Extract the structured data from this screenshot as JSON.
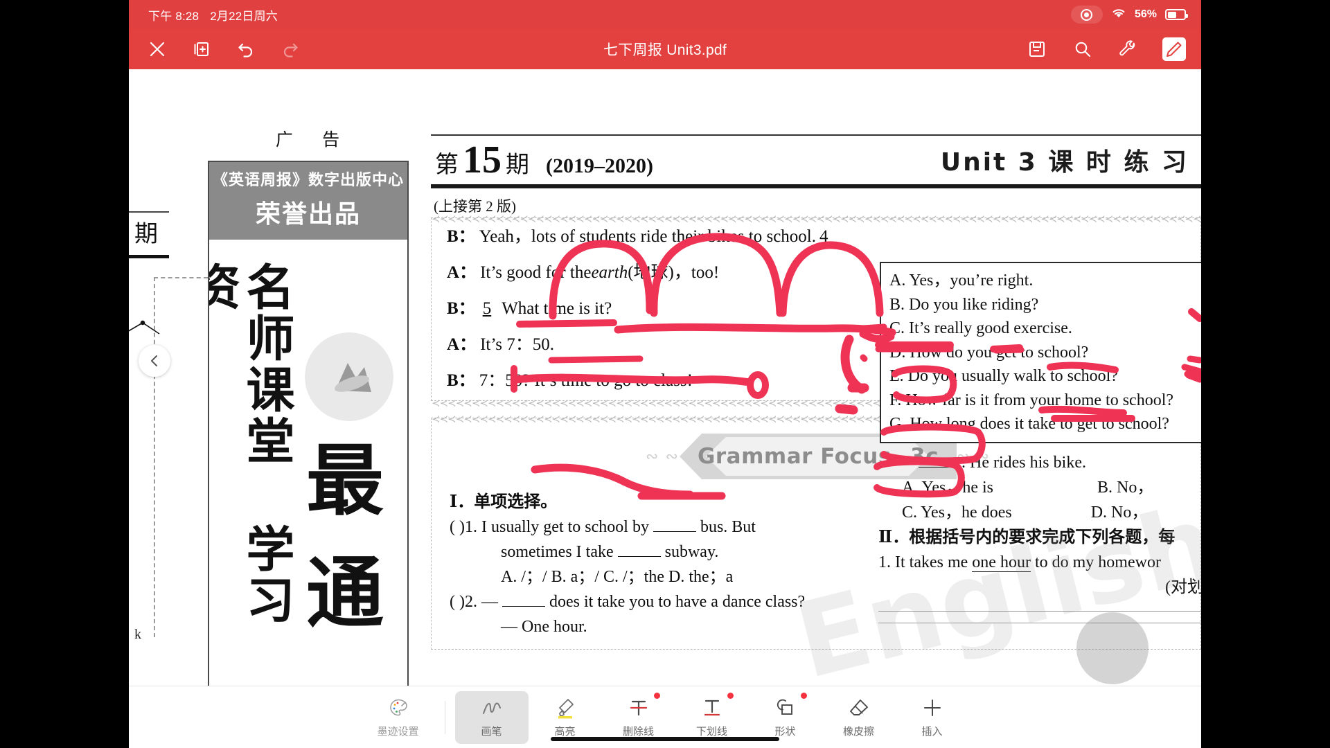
{
  "status_bar": {
    "time": "下午 8:28",
    "date": "2月22日周六",
    "battery_percent": "56%",
    "recording_icon": "record-icon",
    "wifi_icon": "wifi-icon",
    "battery_icon": "battery-icon"
  },
  "toolbar": {
    "title": "七下周报 Unit3.pdf",
    "close_icon": "close-icon",
    "add_page_icon": "add-page-icon",
    "undo_icon": "undo-icon",
    "redo_icon": "redo-icon",
    "save_icon": "save-icon",
    "search_icon": "search-icon",
    "settings_icon": "wrench-icon",
    "edit_icon": "pencil-icon",
    "accent_color": "#e3413f"
  },
  "left_fragment": {
    "qi": "期",
    "k": "k"
  },
  "ad": {
    "label": "广 告",
    "header_line1": "《英语周报》数字出版中心",
    "header_line2": "荣誉出品",
    "vertical_text": "名师课堂 学习资",
    "big1": "最",
    "big2": "通"
  },
  "document": {
    "issue_prefix": "第",
    "issue_number": "15",
    "issue_suffix": "期",
    "issue_years": "(2019–2020)",
    "unit_title": "Unit 3 课 时 练 习",
    "continued_note": "(上接第 2 版)",
    "dialogue": [
      {
        "speaker": "B：",
        "text": "Yeah，lots of students ride their bikes to school.",
        "blank": "4"
      },
      {
        "speaker": "A：",
        "text_pre": "It’s good for the ",
        "italic": "earth",
        "text_post": " (地球)，too!"
      },
      {
        "speaker": "B：",
        "blank": "5",
        "text": "What time is it?"
      },
      {
        "speaker": "A：",
        "text": "It’s 7：50."
      },
      {
        "speaker": "B：",
        "text": "7：50? It’s time to go to class!"
      }
    ],
    "options": [
      "A. Yes，you’re right.",
      "B. Do you like riding?",
      "C. It’s really good exercise.",
      "D. How do you get to school?",
      "E. Do you usually walk to school?",
      "F. How far is it from your home to school?",
      "G. How long does it take to get to school?"
    ],
    "grammar_focus": {
      "banner": "Grammar Focus –3c",
      "section_heading": "Ⅰ．单项选择。",
      "questions": [
        {
          "mark": "(      )1.",
          "line1_a": "I usually get to school by ",
          "line1_b": " bus. But",
          "line2_a": "sometimes I take ",
          "line2_b": " subway.",
          "choices": "A. /；/            B. a；/            C. /；the            D. the；a"
        },
        {
          "mark": "(      )2.",
          "line1_a": "— ",
          "line1_b": " does it take you to have a dance class?",
          "line2": "— One hour."
        }
      ]
    },
    "right_column": {
      "answer_lead_a": "— ",
      "answer_lead_b": ". He rides his bike.",
      "choice_a": "A. Yes，he is",
      "choice_b": "B. No，",
      "choice_c": "C. Yes，he does",
      "choice_d": "D. No，",
      "section2": "Ⅱ．根据括号内的要求完成下列各题，每",
      "q1_pre": "1. It takes me ",
      "q1_underlined": "one hour",
      "q1_post": " to do my homewor",
      "q1_note": "(对划"
    },
    "watermark": "English W"
  },
  "bottom_tools": [
    {
      "label": "墨迹设置",
      "icon": "palette-icon",
      "selected": false,
      "badge": false,
      "muted": true
    },
    {
      "label": "画笔",
      "icon": "brush-icon",
      "selected": true,
      "badge": false,
      "muted": false
    },
    {
      "label": "高亮",
      "icon": "highlighter-icon",
      "selected": false,
      "badge": false,
      "muted": false
    },
    {
      "label": "删除线",
      "icon": "strikethrough-icon",
      "selected": false,
      "badge": true,
      "muted": false
    },
    {
      "label": "下划线",
      "icon": "underline-icon",
      "selected": false,
      "badge": true,
      "muted": false
    },
    {
      "label": "形状",
      "icon": "shapes-icon",
      "selected": false,
      "badge": true,
      "muted": false
    },
    {
      "label": "橡皮擦",
      "icon": "eraser-icon",
      "selected": false,
      "badge": false,
      "muted": false
    },
    {
      "label": "插入",
      "icon": "plus-icon",
      "selected": false,
      "badge": false,
      "muted": false
    }
  ],
  "ink_color": "#ee3355"
}
